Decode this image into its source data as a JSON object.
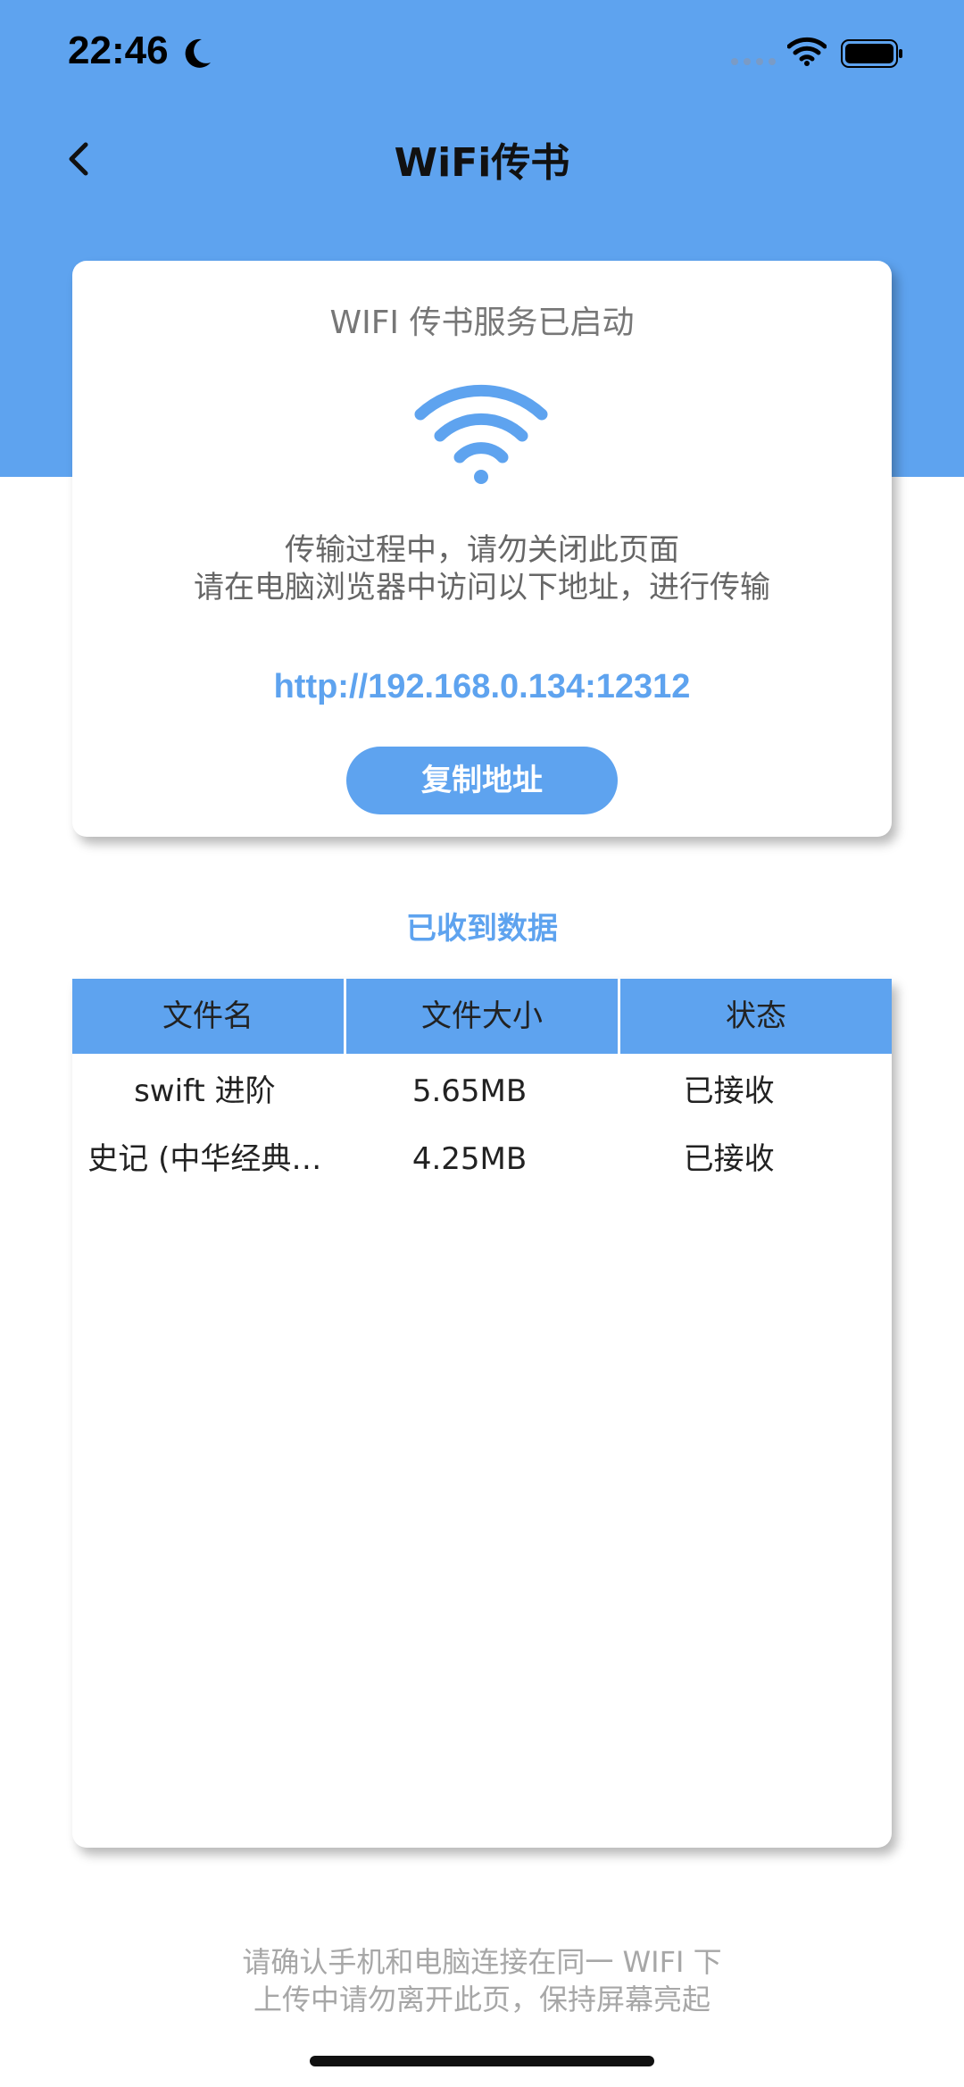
{
  "status_bar": {
    "time": "22:46",
    "icons": [
      "moon-icon",
      "signal-dots-icon",
      "wifi-icon",
      "battery-icon"
    ]
  },
  "nav": {
    "title": "WiFi传书",
    "back_icon": "chevron-left-icon"
  },
  "card": {
    "title": "WIFI 传书服务已启动",
    "icon": "wifi-icon",
    "hint_line1": "传输过程中，请勿关闭此页面",
    "hint_line2": "请在电脑浏览器中访问以下地址，进行传输",
    "url": "http://192.168.0.134:12312",
    "copy_label": "复制地址"
  },
  "received": {
    "title": "已收到数据",
    "columns": [
      "文件名",
      "文件大小",
      "状态"
    ],
    "rows": [
      [
        "swift 进阶",
        "5.65MB",
        "已接收"
      ],
      [
        "史记 (中华经典…",
        "4.25MB",
        "已接收"
      ]
    ]
  },
  "footer": {
    "line1": "请确认手机和电脑连接在同一 WIFI 下",
    "line2": "上传中请勿离开此页，保持屏幕亮起"
  },
  "colors": {
    "accent": "#5ea3ef",
    "footer_text": "#a7a7a7"
  }
}
